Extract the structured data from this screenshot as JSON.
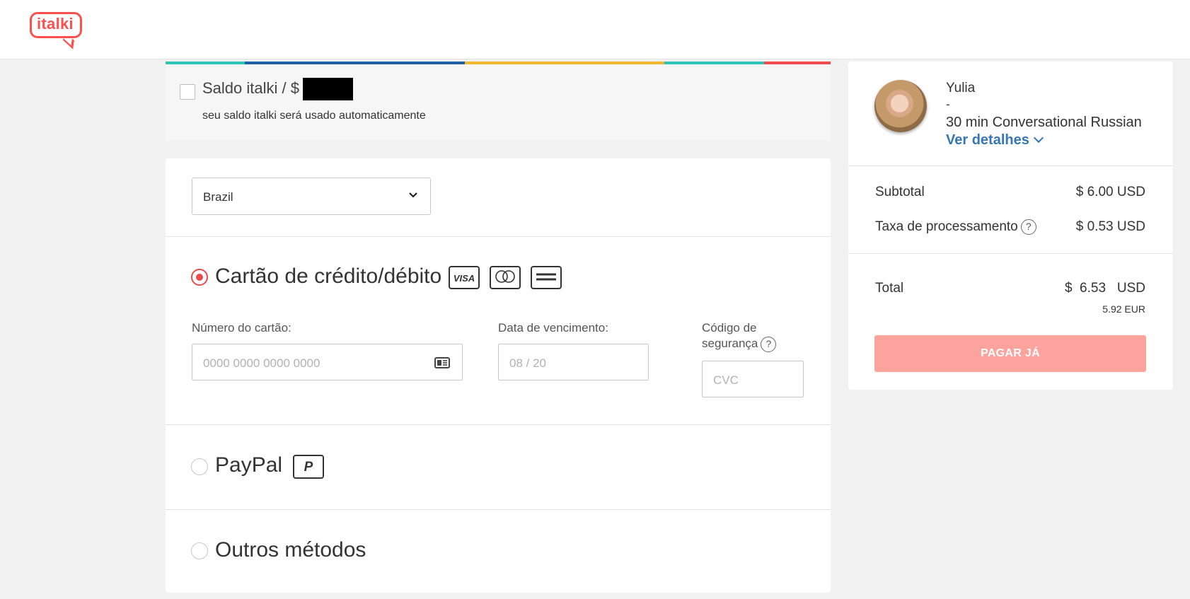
{
  "header": {
    "logo_text": "italki",
    "brand_color": "#ff4f4f"
  },
  "balance": {
    "label": "Saldo italki / $",
    "note": "seu saldo italki será usado automaticamente",
    "checked": false
  },
  "country": {
    "selected": "Brazil"
  },
  "methods": {
    "card": {
      "label": "Cartão de crédito/débito",
      "selected": true,
      "brands": [
        "VISA",
        "mastercard",
        "AMERICAN EXPRESS"
      ],
      "number_label": "Número do cartão:",
      "number_placeholder": "0000 0000 0000 0000",
      "expiry_label": "Data de vencimento:",
      "expiry_placeholder": "08 / 20",
      "cvc_label_1": "Código de",
      "cvc_label_2": "segurança",
      "cvc_help": "?",
      "cvc_placeholder": "CVC"
    },
    "paypal": {
      "label": "PayPal",
      "selected": false,
      "icon_letter": "P"
    },
    "other": {
      "label": "Outros métodos",
      "selected": false
    }
  },
  "summary": {
    "tutor": "Yulia",
    "separator": "-",
    "lesson": "30 min  Conversational Russian",
    "details_link": "Ver detalhes",
    "subtotal_label": "Subtotal",
    "subtotal_value": "$ 6.00 USD",
    "fee_label": "Taxa de processamento",
    "fee_help": "?",
    "fee_value": "$ 0.53 USD",
    "total_label": "Total",
    "total_value": "$  6.53   USD",
    "total_eur": "5.92 EUR",
    "pay_button": "PAGAR JÁ"
  },
  "colors": {
    "accent_red": "#e94b4b",
    "link_blue": "#3577b4",
    "pay_button_bg": "#fca39d",
    "rainbow": [
      "#2ec4b6",
      "#1f5fa8",
      "#f3b72f",
      "#2ec4b6",
      "#ef4c4c"
    ]
  }
}
